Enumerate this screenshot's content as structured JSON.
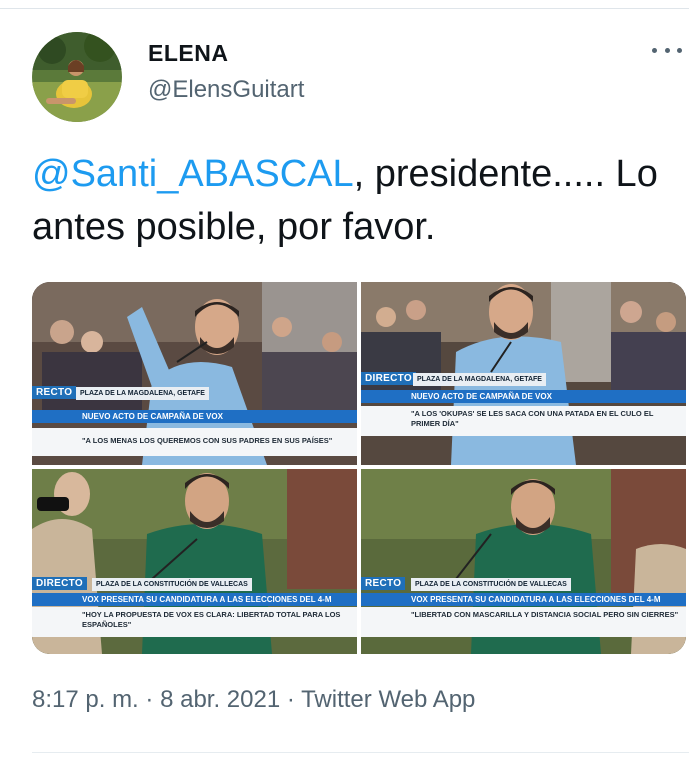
{
  "tweet": {
    "author_name": "ELENA",
    "author_handle": "@ElensGuitart",
    "mention": "@Santi_ABASCAL",
    "text_after_mention": ", presidente..... Lo antes posible, por favor.",
    "time": "8:17 p. m.",
    "date": "8 abr. 2021",
    "source": "Twitter Web App",
    "separator": "·"
  },
  "media": [
    {
      "direct": "RECTO",
      "place": "PLAZA DE LA MAGDALENA, GETAFE",
      "headline": "NUEVO ACTO DE CAMPAÑA DE VOX",
      "quote": "\"A LOS MENAS LOS QUEREMOS CON SUS PADRES EN SUS PAÍSES\"",
      "scene": "shirt-blue-left"
    },
    {
      "direct": "DIRECTO",
      "place": "PLAZA DE LA MAGDALENA, GETAFE",
      "headline": "NUEVO ACTO DE CAMPAÑA DE VOX",
      "quote": "\"A LOS 'OKUPAS' SE LES SACA CON UNA PATADA EN EL CULO EL PRIMER DÍA\"",
      "scene": "shirt-blue-right"
    },
    {
      "direct": "DIRECTO",
      "place": "PLAZA DE LA CONSTITUCIÓN DE VALLECAS",
      "headline": "VOX PRESENTA SU CANDIDATURA A LAS ELECCIONES DEL 4-M",
      "quote": "\"HOY LA PROPUESTA DE VOX ES CLARA: LIBERTAD TOTAL PARA LOS ESPAÑOLES\"",
      "scene": "shirt-green-left"
    },
    {
      "direct": "RECTO",
      "place": "PLAZA DE LA CONSTITUCIÓN DE VALLECAS",
      "headline": "VOX PRESENTA SU CANDIDATURA A LAS ELECCIONES DEL 4-M",
      "quote": "\"LIBERTAD CON MASCARILLA Y DISTANCIA SOCIAL PERO SIN CIERRES\"",
      "scene": "shirt-green-right"
    }
  ],
  "colors": {
    "mention": "#1d9bf0",
    "secondary_text": "#536471",
    "primary_text": "#0f1419",
    "tv_blue": "#1f6fc4"
  },
  "icons": {
    "more": "more-horizontal-icon",
    "avatar": "user-avatar"
  }
}
